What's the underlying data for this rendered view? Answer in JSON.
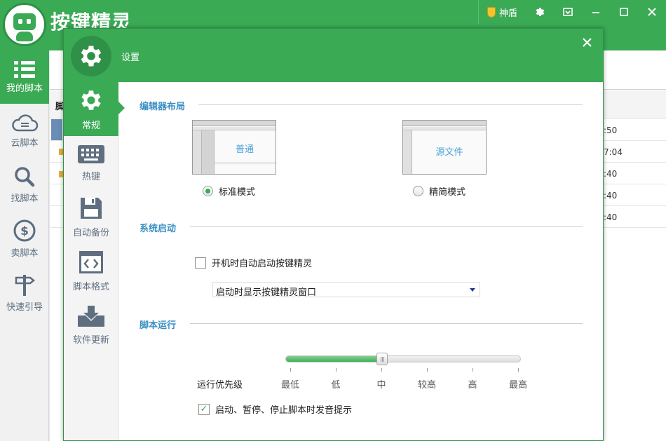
{
  "app": {
    "title": "按键精灵",
    "shield_label": "神盾",
    "nav": [
      {
        "label": "我的脚本",
        "icon": "list-icon",
        "active": true
      },
      {
        "label": "云脚本",
        "icon": "cloud-icon"
      },
      {
        "label": "找脚本",
        "icon": "search-icon"
      },
      {
        "label": "卖脚本",
        "icon": "dollar-icon"
      },
      {
        "label": "快速引导",
        "icon": "signpost-icon"
      }
    ],
    "list_header_partial": "脚",
    "row_times": [
      ":50",
      "7:04",
      ":40",
      ":40",
      ":40"
    ]
  },
  "dialog": {
    "title": "设置",
    "nav": [
      {
        "label": "常规",
        "icon": "gear-icon",
        "active": true
      },
      {
        "label": "热键",
        "icon": "keyboard-icon"
      },
      {
        "label": "自动备份",
        "icon": "floppy-icon"
      },
      {
        "label": "脚本格式",
        "icon": "code-icon"
      },
      {
        "label": "软件更新",
        "icon": "download-icon"
      }
    ],
    "editor_layout": {
      "title": "编辑器布局",
      "preview_normal": "普通",
      "preview_source": "源文件",
      "mode_standard": "标准模式",
      "mode_simple": "精简模式",
      "selected": "标准模式"
    },
    "startup": {
      "title": "系统启动",
      "autostart_label": "开机时自动启动按键精灵",
      "autostart_checked": false,
      "window_option_selected": "启动时显示按键精灵窗口"
    },
    "script_run": {
      "title": "脚本运行",
      "priority_label": "运行优先级",
      "priority_levels": [
        "最低",
        "低",
        "中",
        "较高",
        "高",
        "最高"
      ],
      "priority_selected": "中",
      "sound_label": "启动、暂停、停止脚本时发音提示",
      "sound_checked": true
    }
  },
  "colors": {
    "accent_green": "#3aaa55",
    "section_blue": "#3a8fc2",
    "preview_text_blue": "#4aa3d8"
  }
}
